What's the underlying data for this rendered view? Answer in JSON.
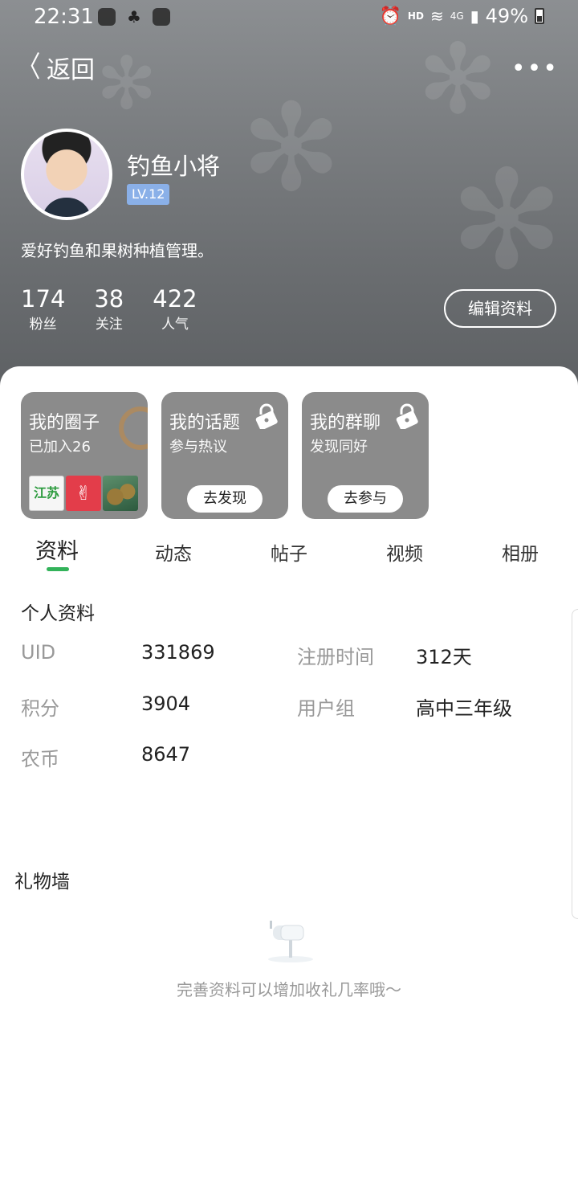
{
  "status_bar": {
    "time": "22:31",
    "hd": "HD",
    "network": "4G",
    "battery": "49%"
  },
  "nav": {
    "back_label": "返回",
    "more_label": "•••"
  },
  "profile": {
    "name": "钓鱼小将",
    "level": "LV.12",
    "bio": "爱好钓鱼和果树种植管理。",
    "stats": [
      {
        "num": "174",
        "label": "粉丝"
      },
      {
        "num": "38",
        "label": "关注"
      },
      {
        "num": "422",
        "label": "人气"
      }
    ],
    "edit_button": "编辑资料"
  },
  "cards": [
    {
      "title": "我的圈子",
      "sub": "已加入26",
      "thumb_labels": [
        "江苏",
        "✌"
      ]
    },
    {
      "title": "我的话题",
      "sub": "参与热议",
      "action": "去发现"
    },
    {
      "title": "我的群聊",
      "sub": "发现同好",
      "action": "去参与"
    }
  ],
  "tabs": [
    "资料",
    "动态",
    "帖子",
    "视频",
    "相册"
  ],
  "active_tab": "资料",
  "personal_info": {
    "title": "个人资料",
    "rows": [
      {
        "k1": "UID",
        "v1": "331869",
        "k2": "注册时间",
        "v2": "312天"
      },
      {
        "k1": "积分",
        "v1": "3904",
        "k2": "用户组",
        "v2": "高中三年级"
      },
      {
        "k1": "农币",
        "v1": "8647",
        "k2": "",
        "v2": ""
      }
    ]
  },
  "gift_wall": {
    "title": "礼物墙",
    "empty_text": "完善资料可以增加收礼几率哦～"
  },
  "colors": {
    "accent": "#33b35a",
    "level_badge": "#8ab0e8",
    "card_bg": "#8b8b8b"
  }
}
